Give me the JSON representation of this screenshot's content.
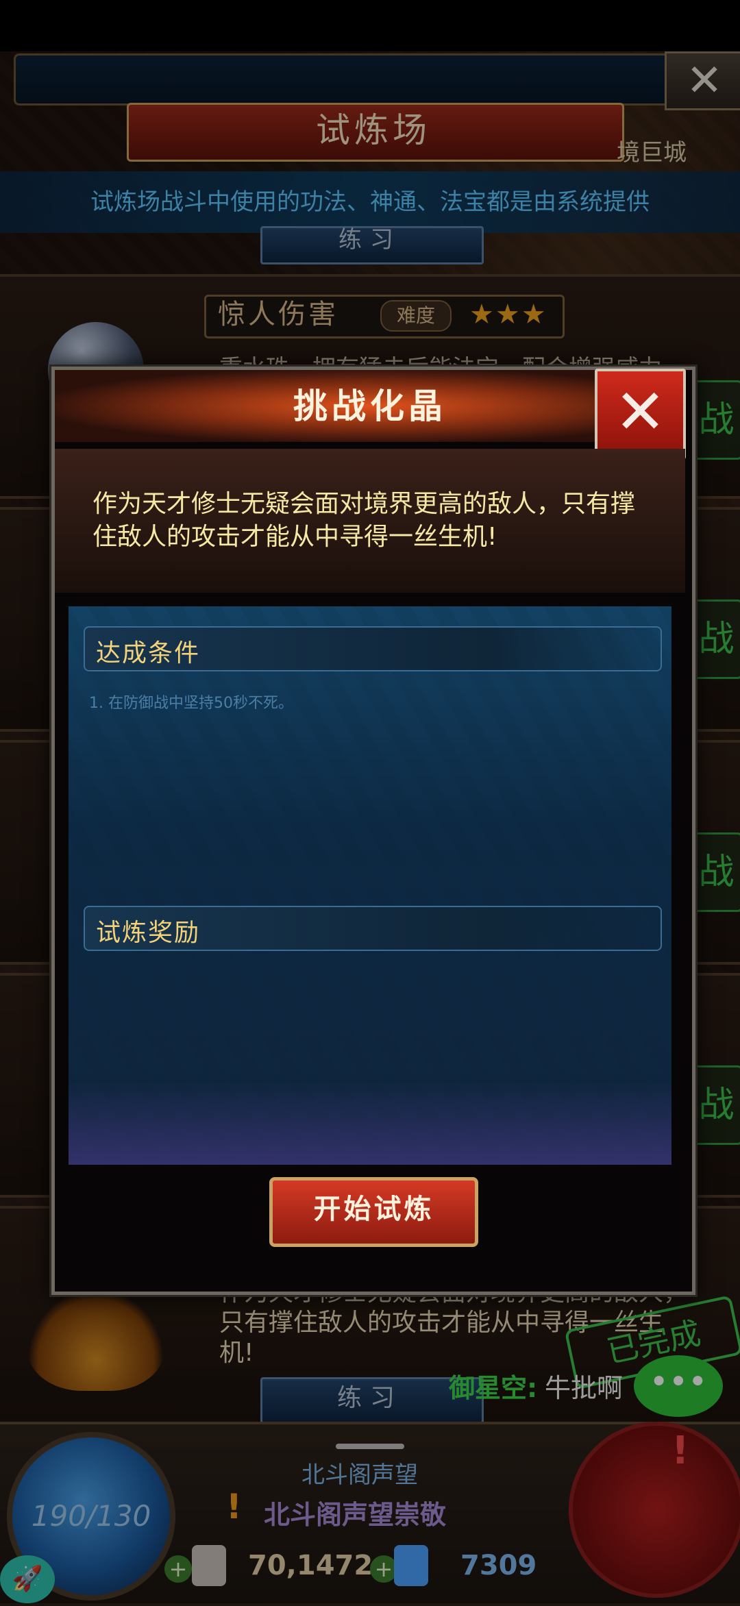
{
  "header": {
    "title": "试炼场",
    "location": "境巨城",
    "notice": "试炼场战斗中使用的功法、神通、法宝都是由系统提供",
    "tab_label": "练习"
  },
  "stage_card": {
    "title": "惊人伤害",
    "difficulty_label": "难度",
    "stars": "★★★",
    "description": "重水珠，拥有猛击后能法宝，配合增强威力"
  },
  "modal": {
    "title": "挑战化晶",
    "close_icon": "✕",
    "intro": "作为天才修士无疑会面对境界更高的敌人，只有撑住敌人的攻击才能从中寻得一丝生机!",
    "conditions_heading": "达成条件",
    "conditions": [
      "1. 在防御战中坚持50秒不死。"
    ],
    "rewards_heading": "试炼奖励",
    "start_button": "开始试炼"
  },
  "lower_card": {
    "description": "作为天才修士无疑会面对境界更高的敌人，只有撑住敌人的攻击才能从中寻得一丝生机!",
    "completed_stamp": "已完成",
    "tab_label": "练习"
  },
  "chat": {
    "name": "御星空:",
    "message": "牛批啊",
    "bubble_icon": "•••"
  },
  "hud": {
    "energy": "190/130",
    "reputation_title": "北斗阁声望",
    "reputation_status": "北斗阁声望崇敬",
    "alert_icon": "!",
    "resource_1": "70,1472",
    "resource_2": "7309",
    "plus_icon": "+",
    "rocket_icon": "🚀",
    "dial_alert": "!"
  },
  "side_stamps": [
    "战",
    "战",
    "战",
    "战"
  ],
  "colors": {
    "accent_red": "#c8261a",
    "gold_text": "#f6e9a6",
    "notice_blue": "#5fc8ff",
    "green": "#3cc24c"
  }
}
